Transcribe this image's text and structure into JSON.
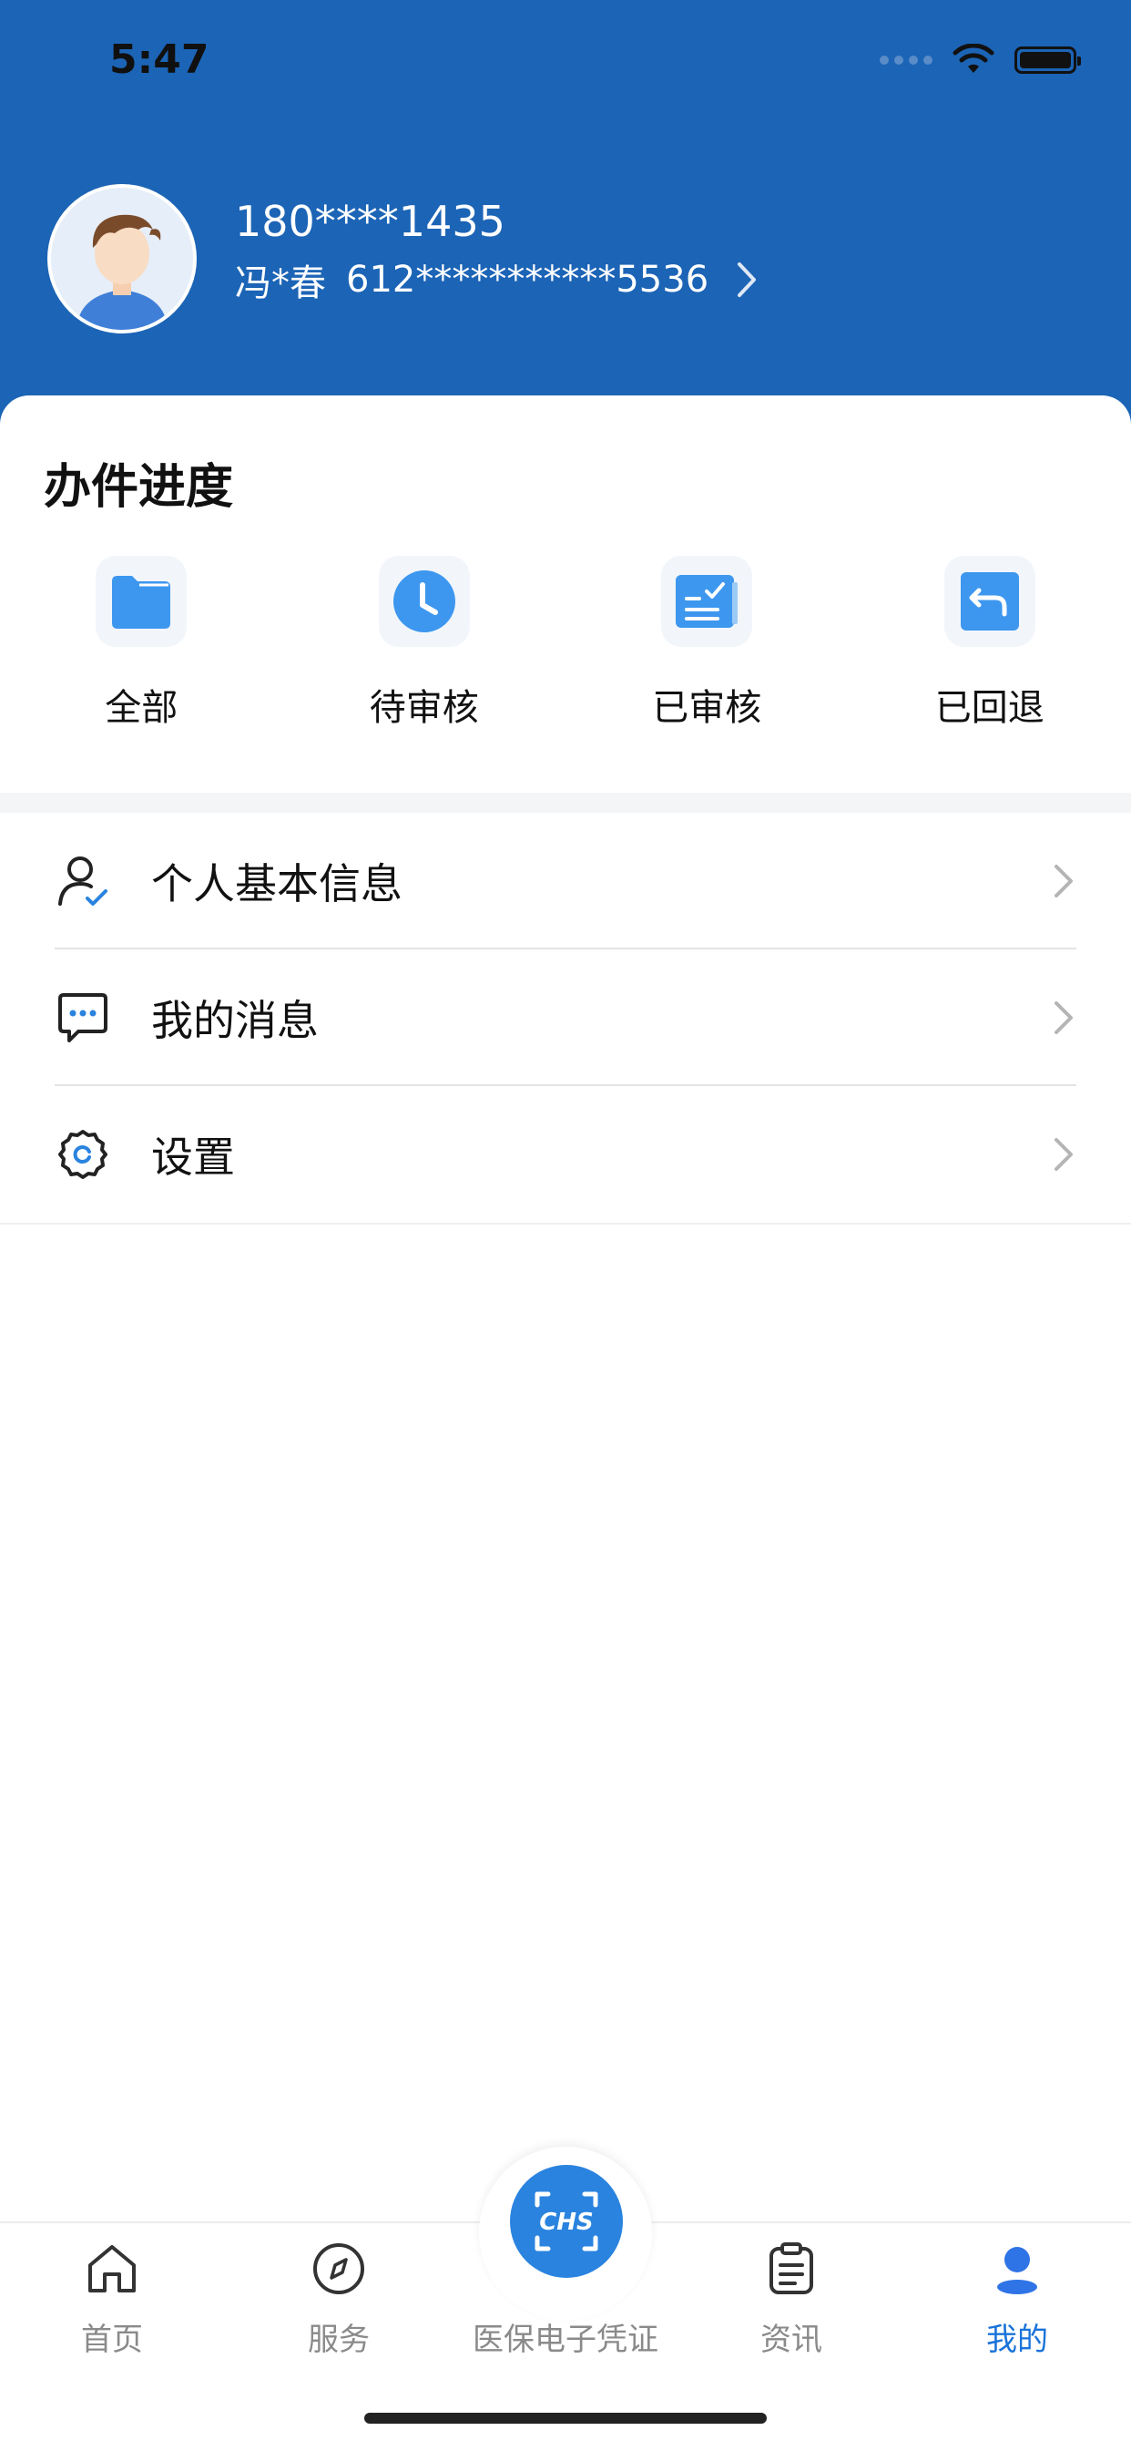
{
  "status_bar": {
    "time": "5:47"
  },
  "profile": {
    "phone": "180****1435",
    "name": "冯*春",
    "id_number": "612***********5536"
  },
  "progress": {
    "title": "办件进度",
    "items": [
      {
        "label": "全部",
        "icon": "folder-icon"
      },
      {
        "label": "待审核",
        "icon": "clock-icon"
      },
      {
        "label": "已审核",
        "icon": "checked-list-icon"
      },
      {
        "label": "已回退",
        "icon": "return-icon"
      }
    ]
  },
  "menu": {
    "items": [
      {
        "label": "个人基本信息",
        "icon": "user-verified-icon"
      },
      {
        "label": "我的消息",
        "icon": "message-icon"
      },
      {
        "label": "设置",
        "icon": "gear-icon"
      }
    ]
  },
  "tabbar": {
    "items": [
      {
        "label": "首页",
        "icon": "home-icon"
      },
      {
        "label": "服务",
        "icon": "compass-icon"
      },
      {
        "label": "医保电子凭证",
        "icon": "chs-scan-icon"
      },
      {
        "label": "资讯",
        "icon": "clipboard-icon"
      },
      {
        "label": "我的",
        "icon": "person-icon"
      }
    ],
    "active": "我的",
    "center_logo_text": "CHS"
  },
  "colors": {
    "header_bg": "#1c64b6",
    "accent": "#2a83df",
    "icon_blue": "#3d97ef",
    "tab_active": "#1a73d9"
  }
}
